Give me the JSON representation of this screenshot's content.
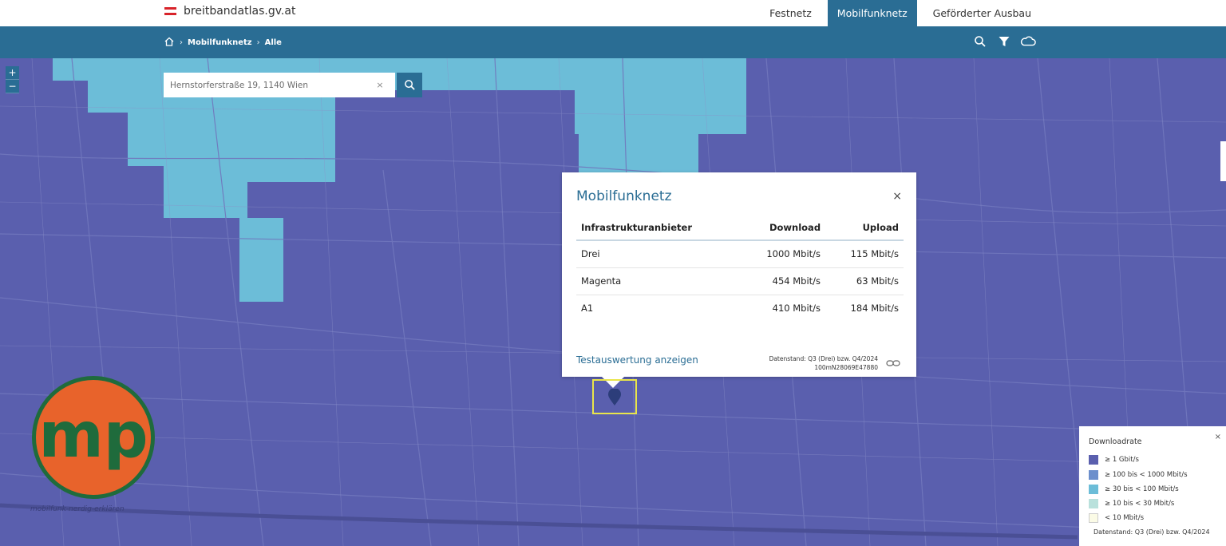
{
  "header": {
    "site": "breitbandatlas.gv.at",
    "nav": [
      {
        "label": "Festnetz",
        "active": false
      },
      {
        "label": "Mobilfunknetz",
        "active": true
      },
      {
        "label": "Geförderter Ausbau",
        "active": false
      }
    ]
  },
  "breadcrumb": {
    "items": [
      "Mobilfunknetz",
      "Alle"
    ],
    "home_icon": "home-icon"
  },
  "toolbar": {
    "icons": [
      "search-icon",
      "filter-icon",
      "cloud-icon"
    ]
  },
  "map": {
    "zoom_in": "+",
    "zoom_out": "−",
    "search": {
      "value": "Hernstorferstraße 19, 1140 Wien",
      "clear": "×"
    }
  },
  "popup": {
    "title": "Mobilfunknetz",
    "close": "×",
    "columns": [
      "Infrastrukturanbieter",
      "Download",
      "Upload"
    ],
    "rows": [
      [
        "Drei",
        "1000 Mbit/s",
        "115 Mbit/s"
      ],
      [
        "Magenta",
        "454 Mbit/s",
        "63 Mbit/s"
      ],
      [
        "A1",
        "410 Mbit/s",
        "184 Mbit/s"
      ]
    ],
    "link": "Testauswertung anzeigen",
    "stand_line1": "Datenstand: Q3 (Drei) bzw. Q4/2024",
    "stand_line2": "100mN28069E47880"
  },
  "legend": {
    "title": "Downloadrate",
    "close": "×",
    "items": [
      {
        "label": "≥ 1 Gbit/s",
        "color": "#5a5fae"
      },
      {
        "label": "≥ 100 bis < 1000 Mbit/s",
        "color": "#6c8fcc"
      },
      {
        "label": "≥ 30 bis < 100 Mbit/s",
        "color": "#6cbdd8"
      },
      {
        "label": "≥ 10 bis < 30 Mbit/s",
        "color": "#b9e1dc"
      },
      {
        "label": "< 10 Mbit/s",
        "color": "#fbfbe6"
      }
    ],
    "footer": "Datenstand: Q3 (Drei) bzw. Q4/2024"
  },
  "watermark": {
    "logo_text": "mp",
    "caption": "mobilfunk-nerdig-erklären"
  },
  "colors": {
    "primary": "#2a6d94",
    "map_gigabit": "#5a5fae",
    "map_30_100": "#6cbdd8",
    "logo_orange": "#e8632b",
    "logo_green": "#1f6b3c"
  }
}
